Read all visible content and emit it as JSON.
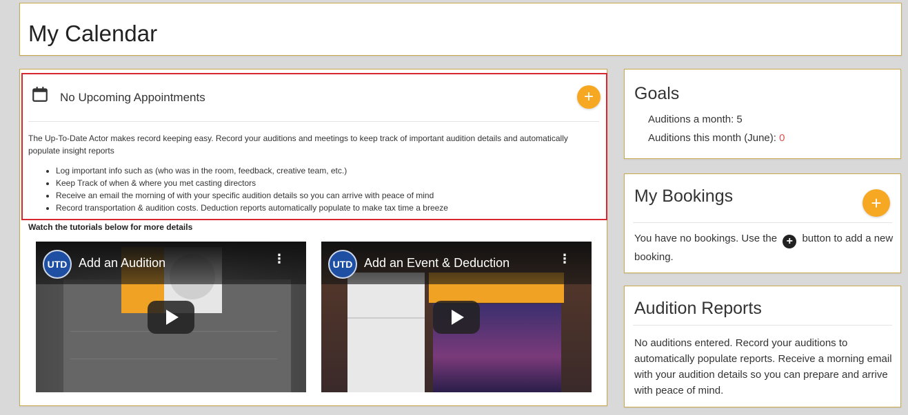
{
  "header": {
    "title": "My Calendar"
  },
  "appointments": {
    "title": "No Upcoming Appointments",
    "add_label": "+",
    "description": "The Up-To-Date Actor makes record keeping easy. Record your auditions and meetings to keep track of important audition details and automatically populate insight reports",
    "bullets": [
      "Log important info such as (who was in the room, feedback, creative team, etc.)",
      "Keep Track of when & where you met casting directors",
      "Receive an email the morning of with your specific audition details so you can arrive with peace of mind",
      "Record transportation & audition costs. Deduction reports automatically populate to make tax time a breeze"
    ],
    "tutorials_label": "Watch the tutorials below for more details"
  },
  "videos": [
    {
      "title": "Add an Audition",
      "logo": "UTD",
      "menu": "⋮"
    },
    {
      "title": "Add an Event & Deduction",
      "logo": "UTD",
      "menu": "⋮"
    }
  ],
  "goals": {
    "heading": "Goals",
    "line1": "Auditions a month: 5",
    "line2_prefix": "Auditions this month (June): ",
    "line2_count": "0"
  },
  "bookings": {
    "heading": "My Bookings",
    "add_label": "+",
    "text_before": "You have no bookings. Use the",
    "inline_icon": "+",
    "text_after": "button to add a new booking."
  },
  "reports": {
    "heading": "Audition Reports",
    "text": "No auditions entered. Record your auditions to automatically populate reports. Receive a morning email with your audition details so you can prepare and arrive with peace of mind."
  },
  "colors": {
    "accent": "#f7a823",
    "border": "#c8a84a",
    "highlight": "#d7262e"
  }
}
